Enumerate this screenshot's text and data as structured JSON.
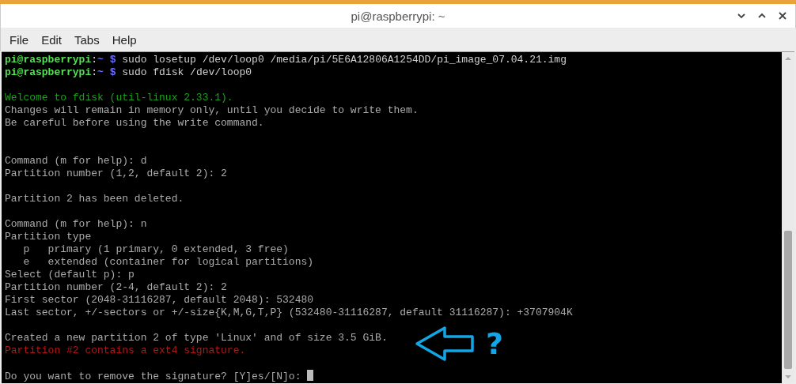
{
  "window": {
    "title": "pi@raspberrypi: ~"
  },
  "menu": [
    "File",
    "Edit",
    "Tabs",
    "Help"
  ],
  "terminal": {
    "lines": [
      {
        "kind": "prompt",
        "user": "pi@raspberrypi",
        "separator": ":",
        "path": "~",
        "symbol": "$",
        "command": "sudo losetup /dev/loop0 /media/pi/5E6A12806A1254DD/pi_image_07.04.21.img"
      },
      {
        "kind": "prompt",
        "user": "pi@raspberrypi",
        "separator": ":",
        "path": "~",
        "symbol": "$",
        "command": "sudo fdisk /dev/loop0"
      },
      {
        "kind": "blank"
      },
      {
        "kind": "output",
        "text": "Welcome to fdisk (util-linux 2.33.1).",
        "color": "#17a317"
      },
      {
        "kind": "output",
        "text": "Changes will remain in memory only, until you decide to write them.",
        "color": "#aaaaaa"
      },
      {
        "kind": "output",
        "text": "Be careful before using the write command.",
        "color": "#aaaaaa"
      },
      {
        "kind": "blank"
      },
      {
        "kind": "blank"
      },
      {
        "kind": "output",
        "text": "Command (m for help): d",
        "color": "#aaaaaa"
      },
      {
        "kind": "output",
        "text": "Partition number (1,2, default 2): 2",
        "color": "#aaaaaa"
      },
      {
        "kind": "blank"
      },
      {
        "kind": "output",
        "text": "Partition 2 has been deleted.",
        "color": "#aaaaaa"
      },
      {
        "kind": "blank"
      },
      {
        "kind": "output",
        "text": "Command (m for help): n",
        "color": "#aaaaaa"
      },
      {
        "kind": "output",
        "text": "Partition type",
        "color": "#aaaaaa"
      },
      {
        "kind": "output",
        "text": "   p   primary (1 primary, 0 extended, 3 free)",
        "color": "#aaaaaa"
      },
      {
        "kind": "output",
        "text": "   e   extended (container for logical partitions)",
        "color": "#aaaaaa"
      },
      {
        "kind": "output",
        "text": "Select (default p): p",
        "color": "#aaaaaa"
      },
      {
        "kind": "output",
        "text": "Partition number (2-4, default 2): 2",
        "color": "#aaaaaa"
      },
      {
        "kind": "output",
        "text": "First sector (2048-31116287, default 2048): 532480",
        "color": "#aaaaaa"
      },
      {
        "kind": "output",
        "text": "Last sector, +/-sectors or +/-size{K,M,G,T,P} (532480-31116287, default 31116287): +3707904K",
        "color": "#aaaaaa"
      },
      {
        "kind": "blank"
      },
      {
        "kind": "output",
        "text": "Created a new partition 2 of type 'Linux' and of size 3.5 GiB.",
        "color": "#aaaaaa"
      },
      {
        "kind": "output",
        "text": "Partition #2 contains a ext4 signature.",
        "color": "#b21818"
      },
      {
        "kind": "blank"
      },
      {
        "kind": "input",
        "text": "Do you want to remove the signature? [Y]es/[N]o: ",
        "color": "#aaaaaa"
      }
    ]
  },
  "annotation": {
    "text": "?"
  }
}
